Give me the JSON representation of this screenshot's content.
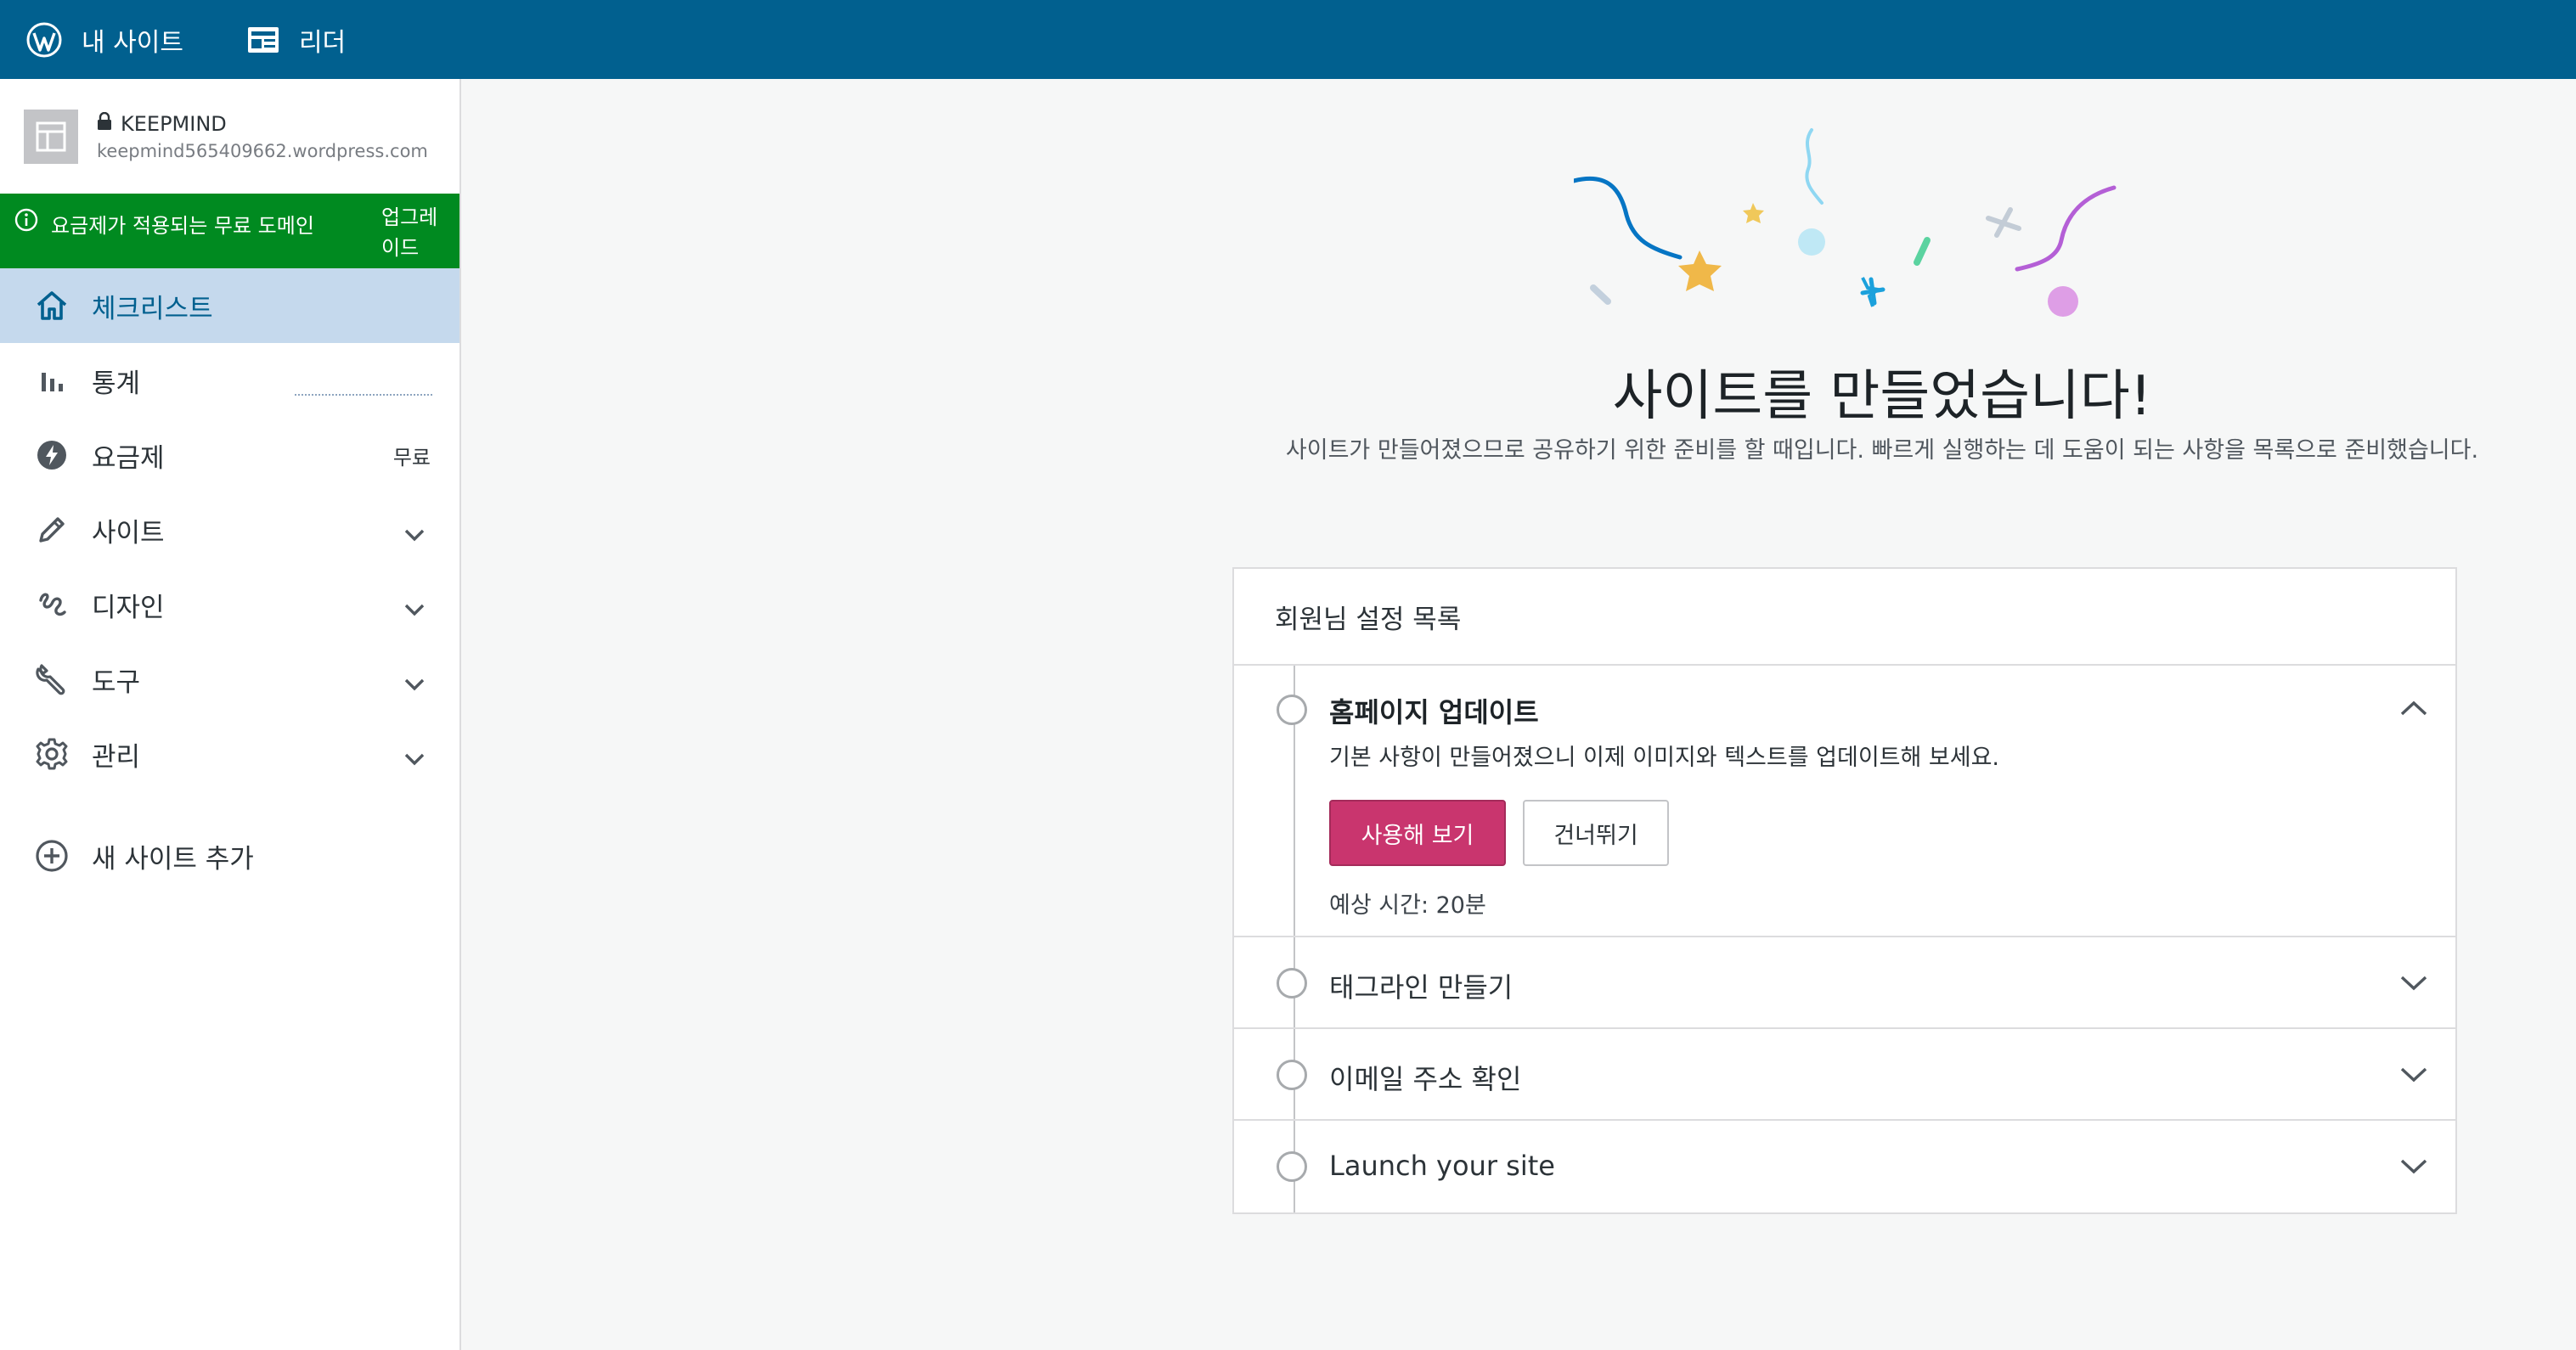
{
  "masterbar": {
    "my_sites": "내 사이트",
    "reader": "리더",
    "icons": {
      "my_sites": "wordpress-logo-icon",
      "reader": "reader-icon"
    }
  },
  "sidebar": {
    "site": {
      "name": "KEEPMIND",
      "url": "keepmind565409662.wordpress.com",
      "private": true
    },
    "domain_banner": {
      "message": "요금제가 적용되는 무료 도메인",
      "cta": "업그레이드"
    },
    "items": [
      {
        "label": "체크리스트",
        "icon": "home-icon",
        "selected": true
      },
      {
        "label": "통계",
        "icon": "stats-icon"
      },
      {
        "label": "요금제",
        "icon": "plan-icon",
        "badge": "무료"
      },
      {
        "label": "사이트",
        "icon": "pencil-icon",
        "expandable": true
      },
      {
        "label": "디자인",
        "icon": "design-icon",
        "expandable": true
      },
      {
        "label": "도구",
        "icon": "wrench-icon",
        "expandable": true
      },
      {
        "label": "관리",
        "icon": "settings-icon",
        "expandable": true
      },
      {
        "label": "새 사이트 추가",
        "icon": "add-circle-icon"
      }
    ]
  },
  "main": {
    "title": "사이트를 만들었습니다!",
    "subtitle": "사이트가 만들어졌으므로 공유하기 위한 준비를 할 때입니다. 빠르게 실행하는 데 도움이 되는 사항을 목록으로 준비했습니다.",
    "checklist": {
      "header": "회원님 설정 목록",
      "tasks": [
        {
          "title": "홈페이지 업데이트",
          "description": "기본 사항이 만들어졌으니 이제 이미지와 텍스트를 업데이트해 보세요.",
          "primary_action": "사용해 보기",
          "secondary_action": "건너뛰기",
          "eta": "예상 시간: 20분",
          "expanded": true
        },
        {
          "title": "태그라인 만들기",
          "expanded": false
        },
        {
          "title": "이메일 주소 확인",
          "expanded": false
        },
        {
          "title": "Launch your site",
          "expanded": false
        }
      ]
    }
  },
  "colors": {
    "masterbar": "#01608f",
    "selected_nav": "#c5d9ed",
    "domain_banner": "#008a20",
    "primary_button": "#c9356e"
  }
}
